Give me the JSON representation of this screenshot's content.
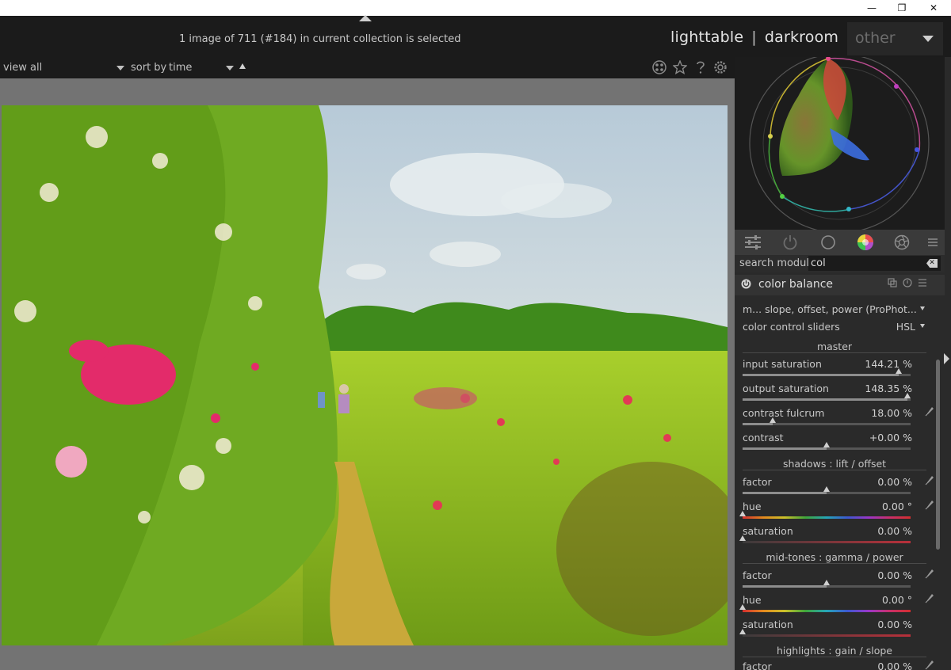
{
  "window": {
    "minimize_glyph": "—",
    "restore_glyph": "❐",
    "close_glyph": "✕"
  },
  "header": {
    "status": "1 image of 711 (#184) in current collection is selected",
    "views": [
      "lighttable",
      "darkroom"
    ],
    "separator": "|",
    "other_label": "other"
  },
  "toolbar": {
    "view_label": "view",
    "view_value": "all",
    "sort_label": "sort by",
    "sort_value": "time",
    "icons": [
      "grouping-icon",
      "star-icon",
      "help-icon",
      "gear-icon"
    ]
  },
  "module_groups": [
    "sliders-icon",
    "power-icon",
    "circle-icon",
    "color-wheel-icon",
    "aperture-icon",
    "menu-icon"
  ],
  "search": {
    "label": "search module",
    "value": "col"
  },
  "module": {
    "title": "color balance",
    "mode_value": "m... slope, offset, power (ProPhot...",
    "sliders_label": "color control sliders",
    "sliders_value": "HSL",
    "sections": {
      "master": "master",
      "shadows": "shadows : lift / offset",
      "midtones": "mid-tones : gamma / power",
      "highlights": "highlights : gain / slope"
    },
    "master": [
      {
        "label": "input saturation",
        "value": "144.21 %",
        "level": 0.93
      },
      {
        "label": "output saturation",
        "value": "148.35 %",
        "level": 0.98
      },
      {
        "label": "contrast fulcrum",
        "value": "18.00 %",
        "level": 0.18
      },
      {
        "label": "contrast",
        "value": "+0.00 %",
        "level": 0.5
      }
    ],
    "shadows": [
      {
        "label": "factor",
        "value": "0.00 %",
        "level": 0.5
      },
      {
        "label": "hue",
        "value": "0.00 °",
        "level": 0.0
      },
      {
        "label": "saturation",
        "value": "0.00 %",
        "level": 0.0
      }
    ],
    "midtones": [
      {
        "label": "factor",
        "value": "0.00 %",
        "level": 0.5
      },
      {
        "label": "hue",
        "value": "0.00 °",
        "level": 0.0
      },
      {
        "label": "saturation",
        "value": "0.00 %",
        "level": 0.0
      }
    ],
    "highlights": [
      {
        "label": "factor",
        "value": "0.00 %"
      }
    ]
  },
  "colors": {
    "accent": "#e2e2e2",
    "panel": "#2a2a2a",
    "background": "#737373"
  }
}
